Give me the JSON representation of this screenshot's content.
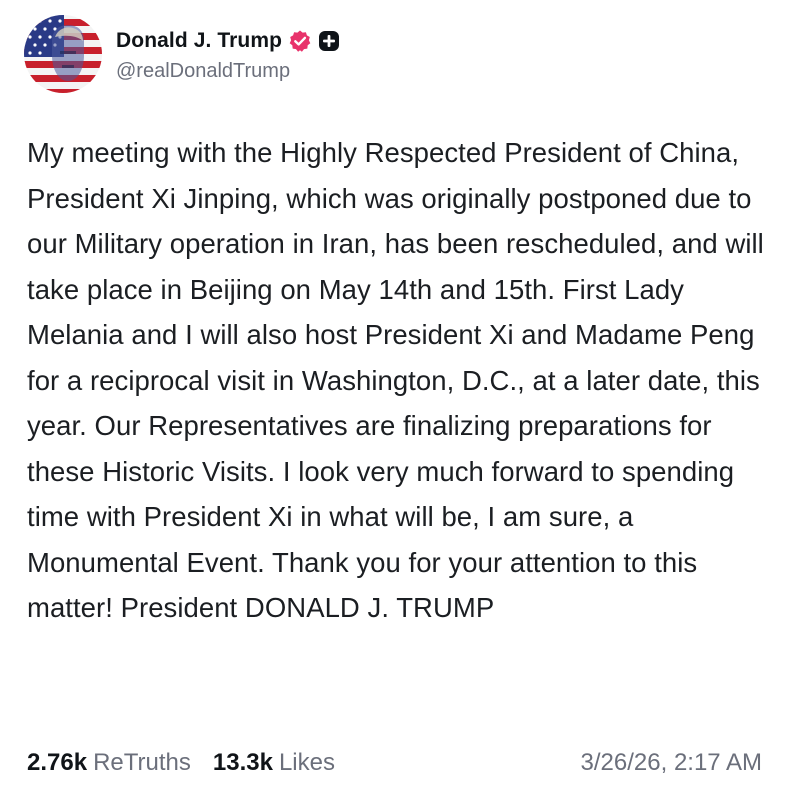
{
  "author": {
    "display_name": "Donald J. Trump",
    "handle": "@realDonaldTrump",
    "verified_icon": "verified-badge-icon",
    "plus_icon": "plus-badge-icon",
    "accent_color": "#e8336b"
  },
  "post": {
    "text": "My meeting with the Highly Respected President of China, President Xi Jinping, which was originally postponed due to our Military operation in Iran, has been rescheduled, and will take place in Beijing on May 14th and 15th. First Lady Melania and I will also host President Xi and Madame Peng for a reciprocal visit in Washington, D.C., at a later date, this year. Our Representatives are finalizing preparations for these Historic Visits. I look very much forward to spending time with President Xi in what will be, I am sure, a Monumental Event. Thank you for your attention to this matter! President DONALD J. TRUMP"
  },
  "stats": {
    "retruths_count": "2.76k",
    "retruths_label": "ReTruths",
    "likes_count": "13.3k",
    "likes_label": "Likes",
    "timestamp": "3/26/26, 2:17 AM"
  }
}
